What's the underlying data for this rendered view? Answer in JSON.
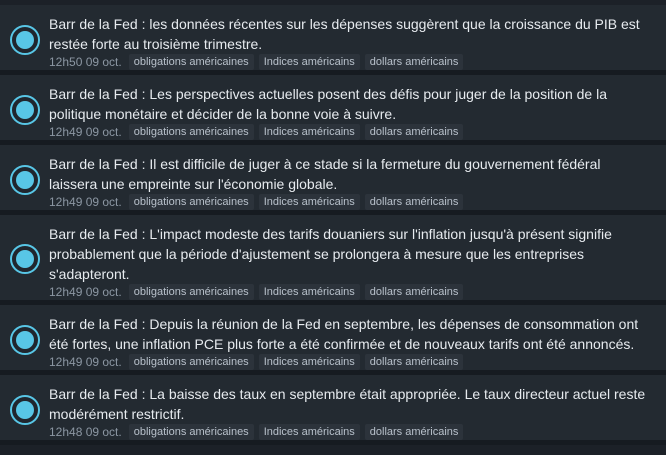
{
  "colors": {
    "background": "#1c2128",
    "row": "#232a31",
    "accent": "#58c6e6",
    "text": "#e7ebef",
    "muted": "#8c97a3",
    "tag_bg": "#2c333b"
  },
  "items": [
    {
      "icon": "status-dot-icon",
      "text": "Barr de la Fed : les données récentes sur les dépenses suggèrent que la croissance du PIB est restée forte au troisième trimestre.",
      "time": "12h50 09 oct.",
      "tags": [
        "obligations américaines",
        "Indices américains",
        "dollars américains"
      ]
    },
    {
      "icon": "status-dot-icon",
      "text": "Barr de la Fed : Les perspectives actuelles posent des défis pour juger de la position de la politique monétaire et décider de la bonne voie à suivre.",
      "time": "12h49 09 oct.",
      "tags": [
        "obligations américaines",
        "Indices américains",
        "dollars américains"
      ]
    },
    {
      "icon": "status-dot-icon",
      "text": "Barr de la Fed : Il est difficile de juger à ce stade si la fermeture du gouvernement fédéral laissera une empreinte sur l'économie globale.",
      "time": "12h49 09 oct.",
      "tags": [
        "obligations américaines",
        "Indices américains",
        "dollars américains"
      ]
    },
    {
      "icon": "status-dot-icon",
      "text": "Barr de la Fed : L'impact modeste des tarifs douaniers sur l'inflation jusqu'à présent signifie probablement que la période d'ajustement se prolongera à mesure que les entreprises s'adapteront.",
      "time": "12h49 09 oct.",
      "tags": [
        "obligations américaines",
        "Indices américains",
        "dollars américains"
      ]
    },
    {
      "icon": "status-dot-icon",
      "text": "Barr de la Fed : Depuis la réunion de la Fed en septembre, les dépenses de consommation ont été fortes, une inflation PCE plus forte a été confirmée et de nouveaux tarifs ont été annoncés.",
      "time": "12h49 09 oct.",
      "tags": [
        "obligations américaines",
        "Indices américains",
        "dollars américains"
      ]
    },
    {
      "icon": "status-dot-icon",
      "text": "Barr de la Fed : La baisse des taux en septembre était appropriée. Le taux directeur actuel reste modérément restrictif.",
      "time": "12h48 09 oct.",
      "tags": [
        "obligations américaines",
        "Indices américains",
        "dollars américains"
      ]
    }
  ]
}
